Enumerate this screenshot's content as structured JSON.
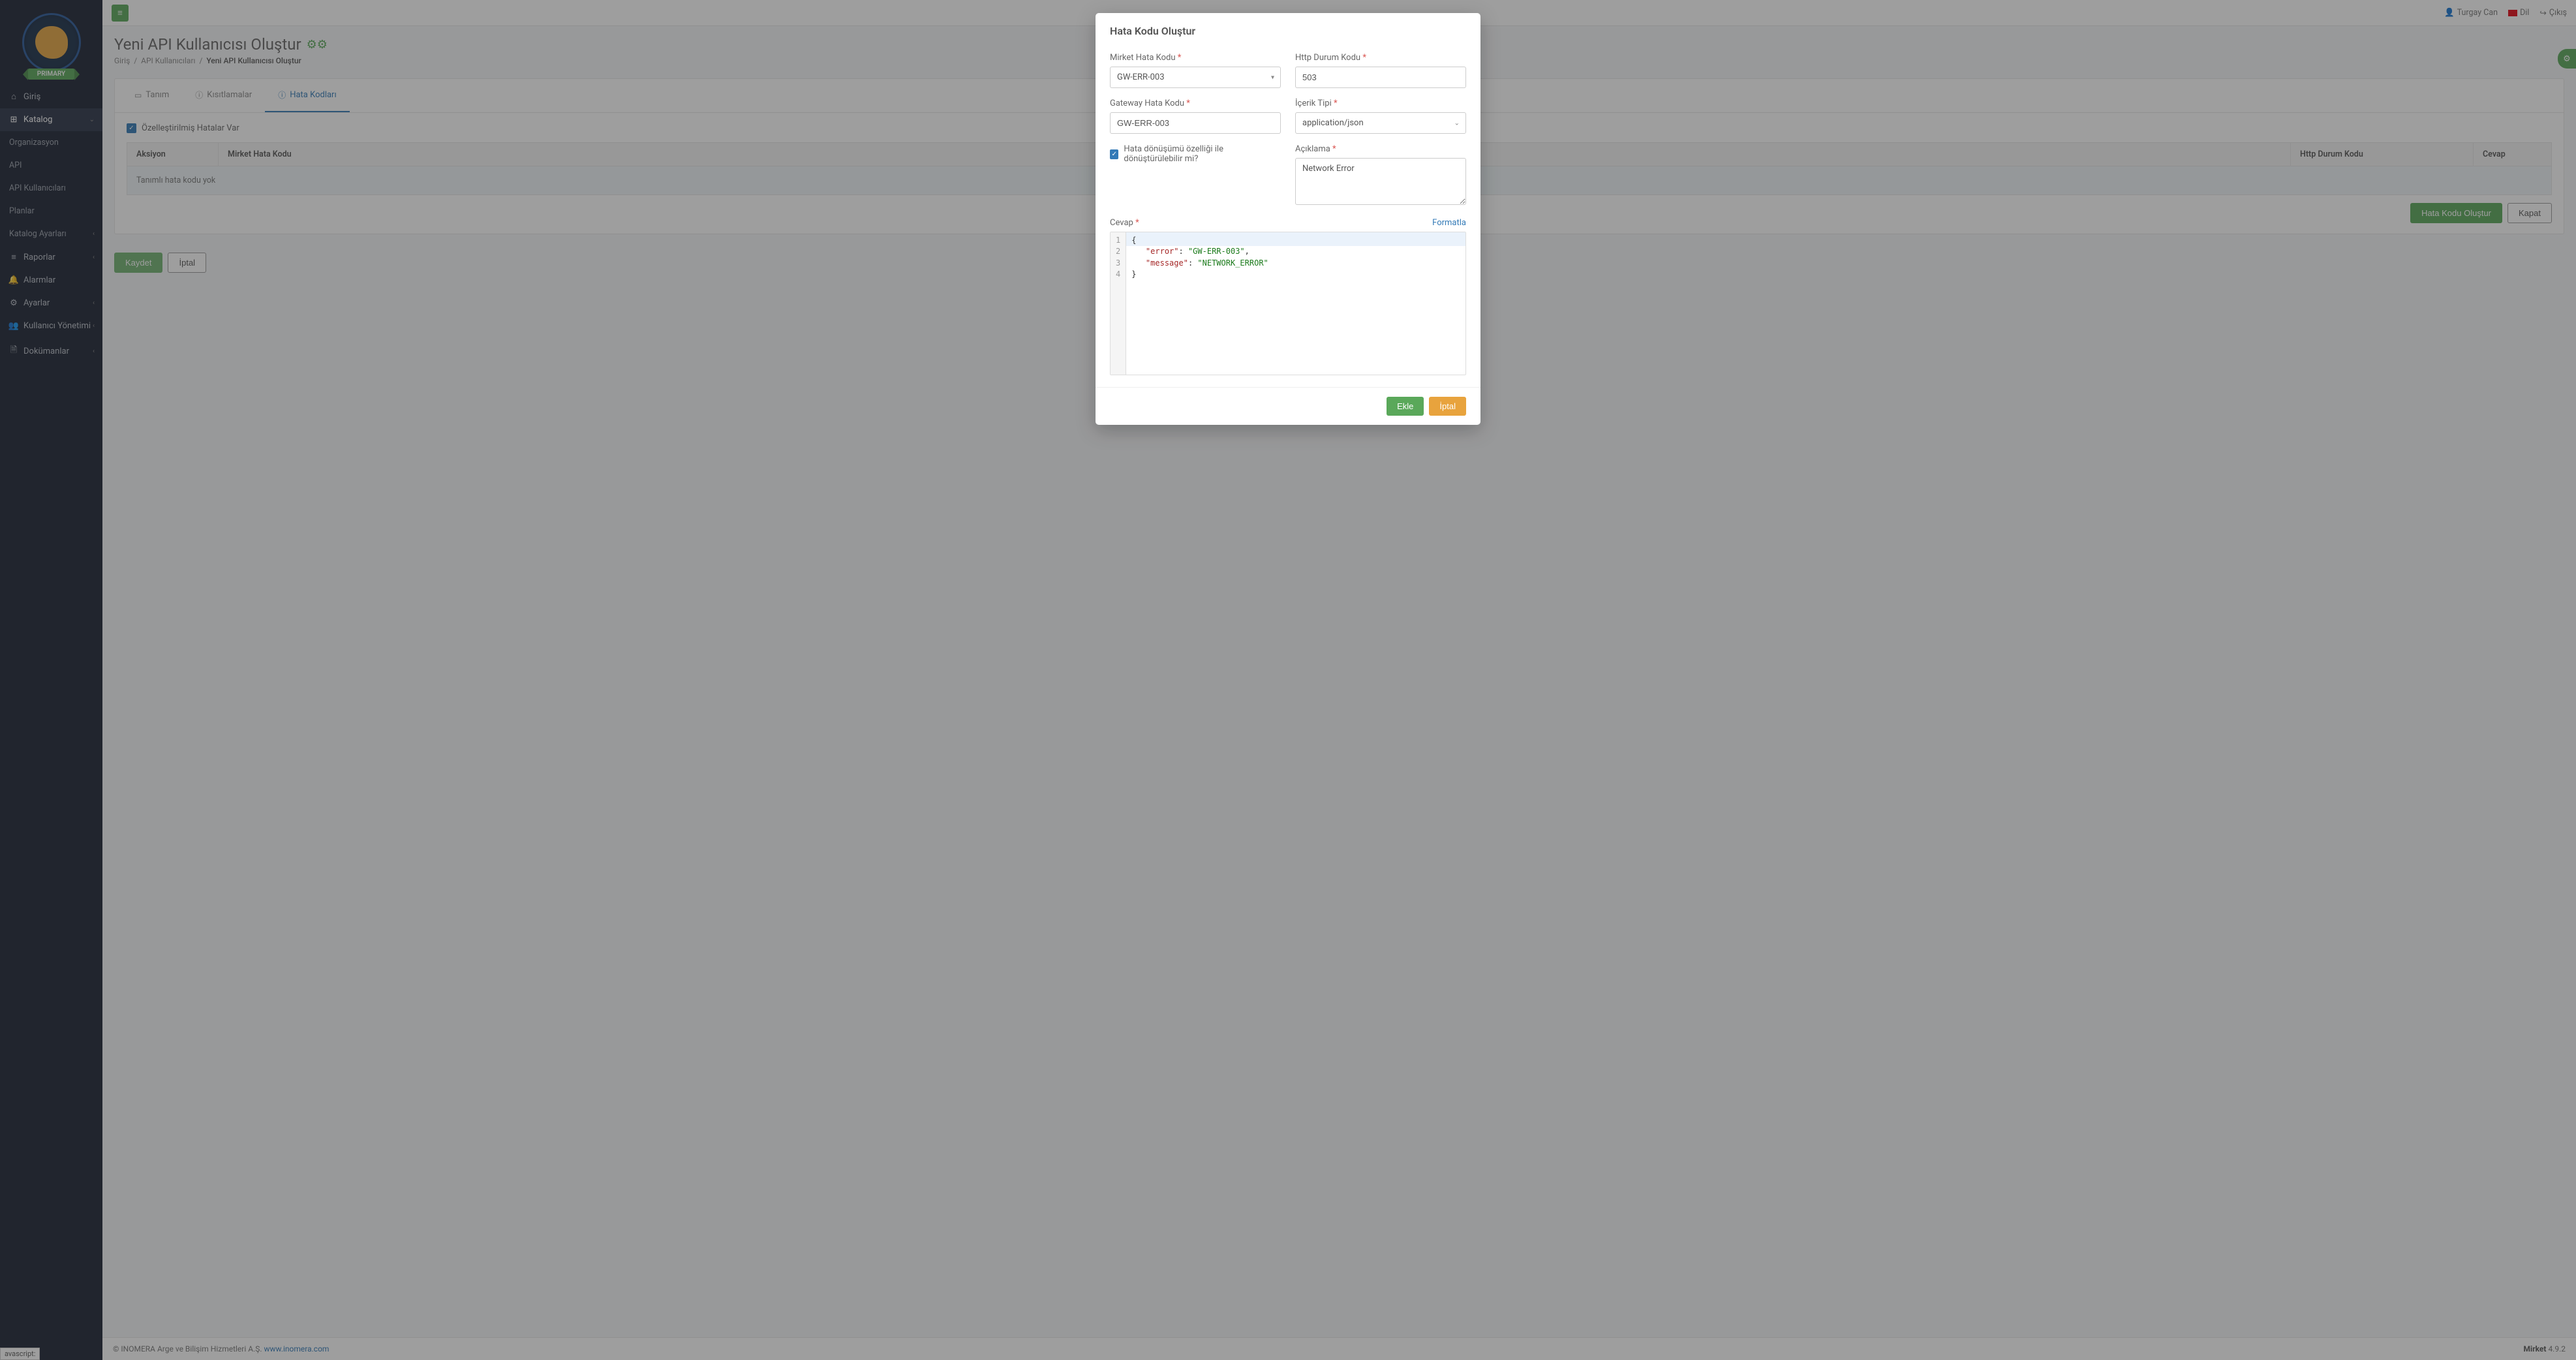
{
  "brand": {
    "badge": "PRIMARY"
  },
  "topbar": {
    "user": "Turgay Can",
    "lang": "Dil",
    "logout": "Çıkış"
  },
  "nav": {
    "home": "Giriş",
    "catalog": "Katalog",
    "org": "Organizasyon",
    "api": "API",
    "api_users": "API Kullanıcıları",
    "plans": "Planlar",
    "catalog_settings": "Katalog Ayarları",
    "reports": "Raporlar",
    "alarms": "Alarmlar",
    "settings": "Ayarlar",
    "user_mgmt": "Kullanıcı Yönetimi",
    "docs": "Dokümanlar"
  },
  "page": {
    "title": "Yeni API Kullanıcısı Oluştur",
    "crumb1": "Giriş",
    "crumb2": "API Kullanıcıları",
    "crumb3": "Yeni API Kullanıcısı Oluştur"
  },
  "tabs": {
    "definition": "Tanım",
    "restrictions": "Kısıtlamalar",
    "error_codes": "Hata Kodları"
  },
  "content": {
    "custom_errors": "Özelleştirilmiş Hatalar Var",
    "col_action": "Aksiyon",
    "col_mirket": "Mirket Hata Kodu",
    "col_http": "Http Durum Kodu",
    "col_answer": "Cevap",
    "empty": "Tanımlı hata kodu yok",
    "create_btn": "Hata Kodu Oluştur",
    "close_btn": "Kapat",
    "save_btn": "Kaydet",
    "cancel_btn": "İptal"
  },
  "modal": {
    "title": "Hata Kodu Oluştur",
    "lbl_mirket": "Mirket Hata Kodu",
    "val_mirket": "GW-ERR-003",
    "lbl_http": "Http Durum Kodu",
    "val_http": "503",
    "lbl_gateway": "Gateway Hata Kodu",
    "val_gateway": "GW-ERR-003",
    "lbl_content": "İçerik Tipi",
    "val_content": "application/json",
    "lbl_convert": "Hata dönüşümü özelliği ile dönüştürülebilir mi?",
    "lbl_desc": "Açıklama",
    "val_desc": "Network Error",
    "lbl_answer": "Cevap",
    "format": "Formatla",
    "code_l1": "{",
    "code_k1": "\"error\"",
    "code_v1": "\"GW-ERR-003\"",
    "code_k2": "\"message\"",
    "code_v2": "\"NETWORK_ERROR\"",
    "code_l4": "}",
    "add": "Ekle",
    "cancel": "İptal"
  },
  "footer": {
    "copy": "© INOMERA Arge ve Bilişim Hizmetleri A.Ş.",
    "url": "www.inomera.com",
    "ver_label": "Mirket",
    "ver": "4.9.2"
  },
  "status": "avascript:"
}
